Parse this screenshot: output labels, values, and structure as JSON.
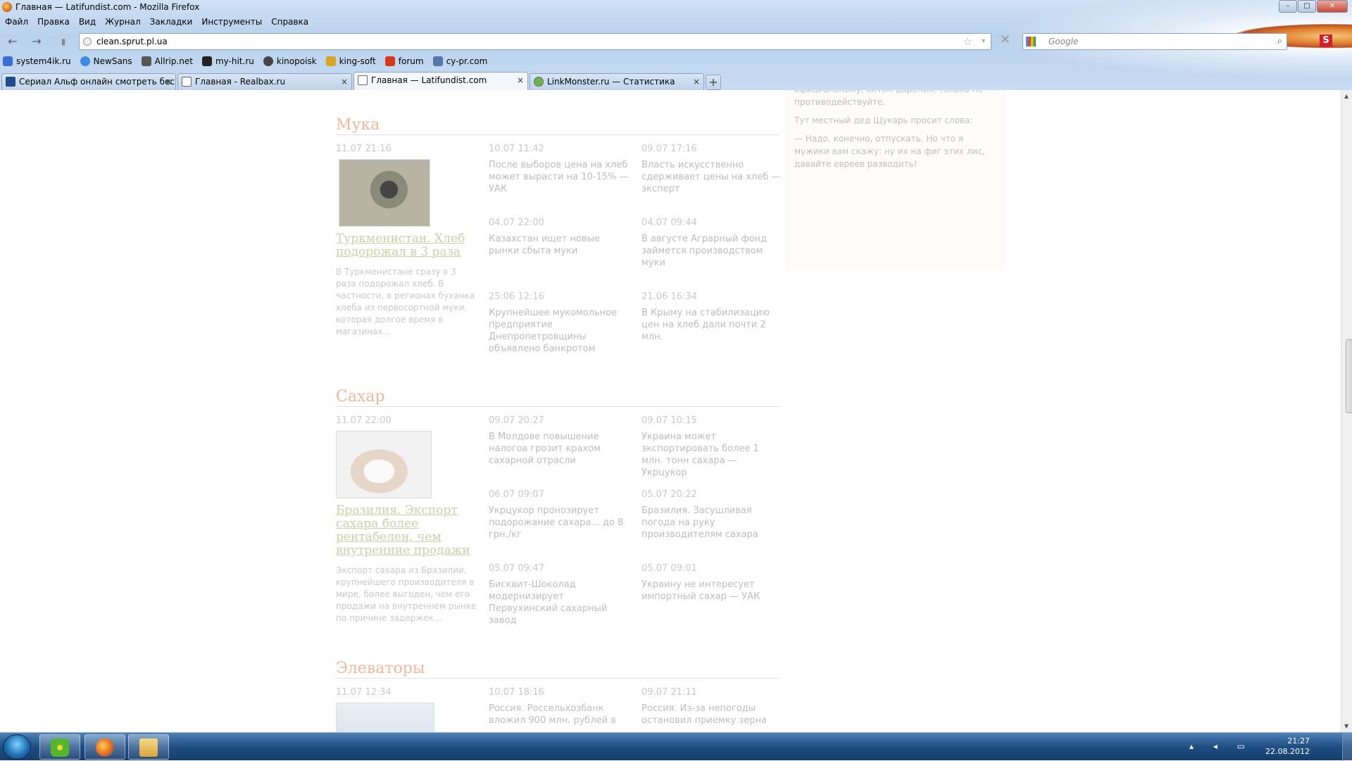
{
  "window": {
    "title": "Главная — Latifundist.com - Mozilla Firefox",
    "min": "–",
    "max": "□",
    "close": "✕"
  },
  "menu": [
    "Файл",
    "Правка",
    "Вид",
    "Журнал",
    "Закладки",
    "Инструменты",
    "Справка"
  ],
  "nav": {
    "back": "←",
    "forward": "→",
    "url": "clean.sprut.pl.ua",
    "star": "☆",
    "dropdown": "▾",
    "stop": "✕",
    "search_placeholder": "Google",
    "search_go": "⌕",
    "addon": "S"
  },
  "bookmarks": [
    {
      "label": "system4ik.ru",
      "color": "#3b6fd4"
    },
    {
      "label": "NewSans",
      "color": "#3d8be0"
    },
    {
      "label": "Allrip.net",
      "color": "#555555"
    },
    {
      "label": "my-hit.ru",
      "color": "#222222"
    },
    {
      "label": "kinopoisk",
      "color": "#444444"
    },
    {
      "label": "king-soft",
      "color": "#d9a420"
    },
    {
      "label": "forum",
      "color": "#d63a1a"
    },
    {
      "label": "cy-pr.com",
      "color": "#5577aa"
    }
  ],
  "tabs": [
    {
      "label": "Сериал Альф онлайн смотреть бес...",
      "close": "×"
    },
    {
      "label": "Главная - Realbax.ru",
      "close": "×"
    },
    {
      "label": "Главная — Latifundist.com",
      "close": "×"
    },
    {
      "label": "LinkMonster.ru — Статистика",
      "close": "×"
    }
  ],
  "newtab": "+",
  "sidebox": {
    "p1": "официальному, актом дарения, только не противодействуйте.",
    "p2": "Тут местный дед Щукарь просит слова:",
    "p3": "— Надо, конечно, отпускать. Но что я мужики вам скажу: ну их на фиг этих лис, давайте евреев разводить!"
  },
  "sections": [
    {
      "title": "Мука",
      "lead": {
        "date": "11.07 21:16",
        "title": "Туркменистан. Хлеб подорожал в 3 раза",
        "text": "В Туркменистане сразу в 3 раза подорожал хлеб. В частности, в регионах буханка хлеба из первосортной муки, которая долгое время в магазинах..."
      },
      "items": [
        {
          "date": "10.07 11:42",
          "title": "После выборов цена на хлеб может вырасти на 10-15% — УАК"
        },
        {
          "date": "09.07 17:16",
          "title": "Власть искусственно сдерживает цены на хлеб — эксперт"
        },
        {
          "date": "04.07 22:00",
          "title": "Казахстан ищет новые рынки сбыта муки"
        },
        {
          "date": "04.07 09:44",
          "title": "В августе Аграрный фонд займется производством муки"
        },
        {
          "date": "25.06 12:16",
          "title": "Крупнейшее мукомольное предприятие Днепропетровщины объявлено банкротом"
        },
        {
          "date": "21.06 16:34",
          "title": "В Крыму на стабилизацию цен на хлеб дали почти 2 млн."
        }
      ]
    },
    {
      "title": "Сахар",
      "lead": {
        "date": "11.07 22:00",
        "title": "Бразилия. Экспорт сахара более рентабелен, чем внутренние продажи",
        "text": "Экспорт сахара из Бразилии, крупнейшего производителя в мире, более выгоден, чем его продажи на внутреннем рынке по причине задержек..."
      },
      "items": [
        {
          "date": "09.07 20:27",
          "title": "В Молдове повышение налогов грозит крахом сахарной отрасли"
        },
        {
          "date": "09.07 10:15",
          "title": "Украина может экспортировать более 1 млн. тонн сахара — Укрцукор"
        },
        {
          "date": "06.07 09:07",
          "title": "Укрцукор пронозирует подорожание сахара... до 8 грн./кг"
        },
        {
          "date": "05.07 20:22",
          "title": "Бразилия. Засушливая погода на руку производителям сахара"
        },
        {
          "date": "05.07 09:47",
          "title": "Бисквит-Шоколад модернизирует Первухинский сахарный завод"
        },
        {
          "date": "05.07 09:01",
          "title": "Украину не интересует импортный сахар — УАК"
        }
      ]
    },
    {
      "title": "Элеваторы",
      "lead": {
        "date": "11.07 12:34"
      },
      "items": [
        {
          "date": "10.07 18:16",
          "title": "Россия. Россельхозбанк вложил 900 млн. рублей в"
        },
        {
          "date": "09.07 21:11",
          "title": "Россия. Из-за непогоды остановил приемку зерна"
        }
      ]
    }
  ],
  "scrollbar": {
    "up": "▲",
    "down": "▼"
  },
  "taskbar": {
    "time": "21:27",
    "date": "22.08.2012",
    "tray_icons": "▴ ◂ ▭"
  }
}
